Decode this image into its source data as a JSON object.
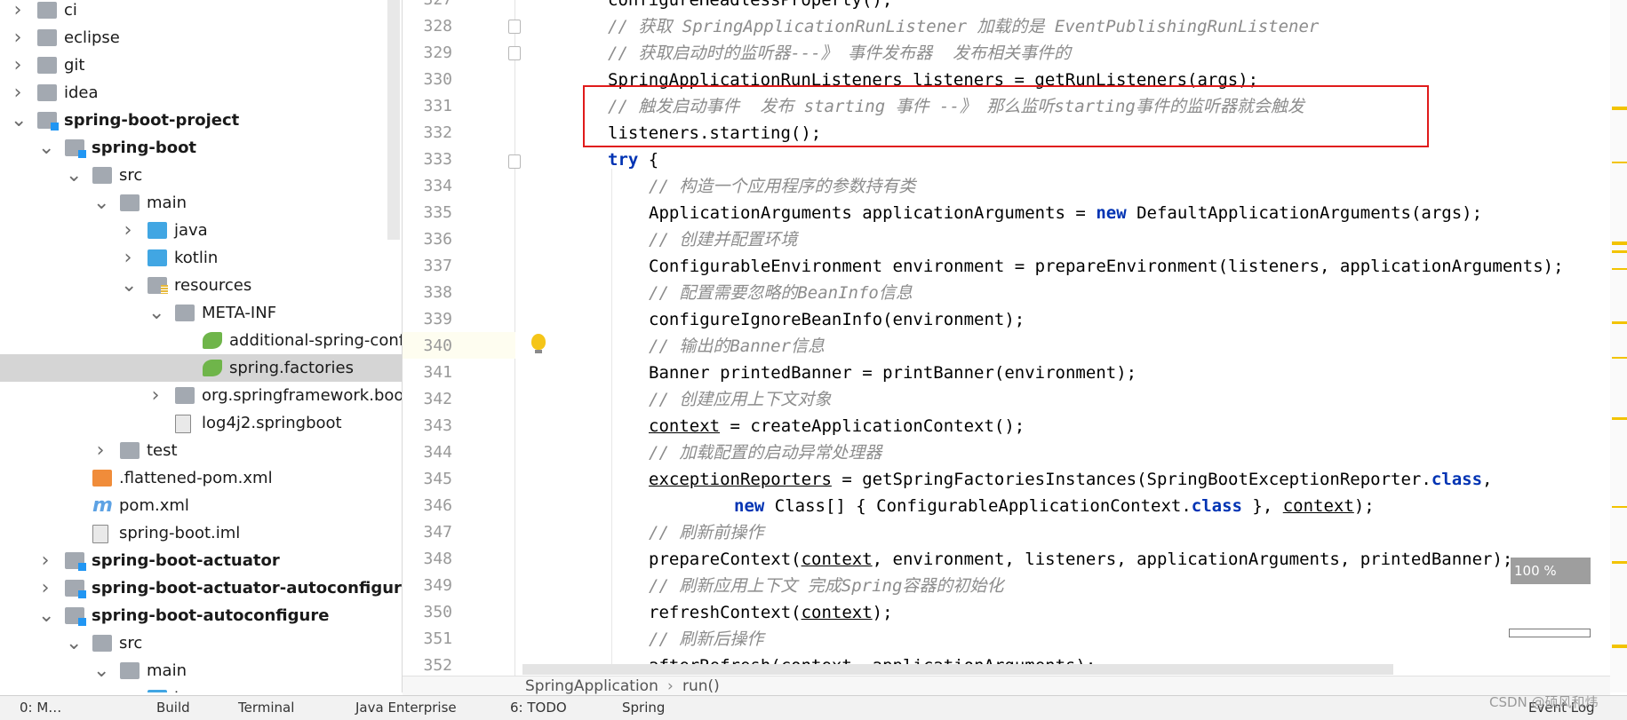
{
  "project_tree": {
    "items": [
      {
        "label": "ci",
        "bold": false,
        "selected": false
      },
      {
        "label": "eclipse",
        "bold": false,
        "selected": false
      },
      {
        "label": "git",
        "bold": false,
        "selected": false
      },
      {
        "label": "idea",
        "bold": false,
        "selected": false
      },
      {
        "label": "spring-boot-project",
        "bold": true,
        "selected": false
      },
      {
        "label": "spring-boot",
        "bold": true,
        "selected": false
      },
      {
        "label": "src",
        "bold": false,
        "selected": false
      },
      {
        "label": "main",
        "bold": false,
        "selected": false
      },
      {
        "label": "java",
        "bold": false,
        "selected": false
      },
      {
        "label": "kotlin",
        "bold": false,
        "selected": false
      },
      {
        "label": "resources",
        "bold": false,
        "selected": false
      },
      {
        "label": "META-INF",
        "bold": false,
        "selected": false
      },
      {
        "label": "additional-spring-configuration-metadata.json",
        "bold": false,
        "selected": false
      },
      {
        "label": "spring.factories",
        "bold": false,
        "selected": true
      },
      {
        "label": "org.springframework.boot",
        "bold": false,
        "selected": false
      },
      {
        "label": "log4j2.springboot",
        "bold": false,
        "selected": false
      },
      {
        "label": "test",
        "bold": false,
        "selected": false
      },
      {
        "label": ".flattened-pom.xml",
        "bold": false,
        "selected": false
      },
      {
        "label": "pom.xml",
        "bold": false,
        "selected": false
      },
      {
        "label": "spring-boot.iml",
        "bold": false,
        "selected": false
      },
      {
        "label": "spring-boot-actuator",
        "bold": true,
        "selected": false
      },
      {
        "label": "spring-boot-actuator-autoconfigure",
        "bold": true,
        "selected": false
      },
      {
        "label": "spring-boot-autoconfigure",
        "bold": true,
        "selected": false
      },
      {
        "label": "src",
        "bold": false,
        "selected": false
      },
      {
        "label": "main",
        "bold": false,
        "selected": false
      },
      {
        "label": "java",
        "bold": false,
        "selected": false
      }
    ]
  },
  "editor": {
    "line_numbers": [
      "327",
      "328",
      "329",
      "330",
      "331",
      "332",
      "333",
      "334",
      "335",
      "336",
      "337",
      "338",
      "339",
      "340",
      "341",
      "342",
      "343",
      "344",
      "345",
      "346",
      "347",
      "348",
      "349",
      "350",
      "351",
      "352"
    ],
    "lines": [
      "configureHeadlessProperty();",
      "// 获取 SpringApplicationRunListener 加载的是 EventPublishingRunListener",
      "// 获取启动时的监听器---》 事件发布器  发布相关事件的",
      "SpringApplicationRunListeners listeners = getRunListeners(args);",
      "// 触发启动事件  发布 starting 事件 --》 那么监听starting事件的监听器就会触发",
      "listeners.starting();",
      "try {",
      "// 构造一个应用程序的参数持有类",
      "ApplicationArguments applicationArguments = new DefaultApplicationArguments(args);",
      "// 创建并配置环境",
      "ConfigurableEnvironment environment = prepareEnvironment(listeners, applicationArguments);",
      "// 配置需要忽略的BeanInfo信息",
      "configureIgnoreBeanInfo(environment);",
      "// 输出的Banner信息",
      "Banner printedBanner = printBanner(environment);",
      "// 创建应用上下文对象",
      "context = createApplicationContext();",
      "// 加载配置的启动异常处理器",
      "exceptionReporters = getSpringFactoriesInstances(SpringBootExceptionReporter.class,",
      "new Class[] { ConfigurableApplicationContext.class }, context);",
      "// 刷新前操作",
      "prepareContext(context, environment, listeners, applicationArguments, printedBanner);",
      "// 刷新应用上下文 完成Spring容器的初始化",
      "refreshContext(context);",
      "// 刷新后操作",
      "afterRefresh(context, applicationArguments);"
    ],
    "zoom": "100 %"
  },
  "breadcrumb": {
    "class_name": "SpringApplication",
    "method": "run()"
  },
  "tool_windows": [
    "0: M…",
    "Build",
    "Terminal",
    "Java Enterprise",
    "6: TODO",
    "Spring",
    "Event Log"
  ],
  "watermark": "CSDN @硕风和炜",
  "colors": {
    "highlight_box": "#e01b1b",
    "keyword": "#0033b3",
    "comment": "#8c8c8c",
    "selection": "#d5d5d5"
  }
}
